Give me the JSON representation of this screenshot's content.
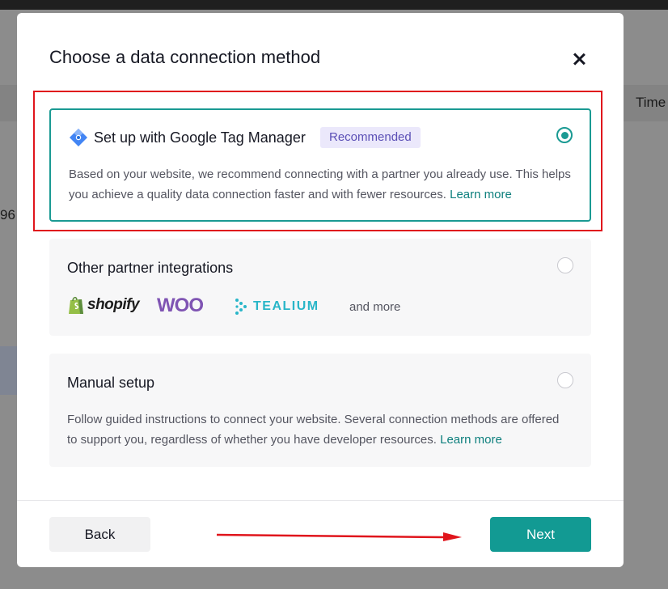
{
  "background": {
    "time_label": "Time",
    "partial_number": "96"
  },
  "modal": {
    "title": "Choose a data connection method",
    "close_icon": "close-icon",
    "options": [
      {
        "title": "Set up with Google Tag Manager",
        "badge": "Recommended",
        "description": "Based on your website, we recommend connecting with a partner you already use. This helps you achieve a quality data connection faster and with fewer resources.",
        "learn_more": "Learn more",
        "selected": true,
        "icon": "google-tag-manager-icon"
      },
      {
        "title": "Other partner integrations",
        "partners": [
          "shopify",
          "WOO",
          "TEALIUM"
        ],
        "and_more": "and more",
        "selected": false
      },
      {
        "title": "Manual setup",
        "description": "Follow guided instructions to connect your website. Several connection methods are offered to support you, regardless of whether you have developer resources.",
        "learn_more": "Learn more",
        "selected": false
      }
    ],
    "back_label": "Back",
    "next_label": "Next"
  },
  "colors": {
    "accent": "#129a93",
    "badge_bg": "#ebe8fb",
    "badge_text": "#5b4fb6",
    "annotation_red": "#e0151c"
  }
}
